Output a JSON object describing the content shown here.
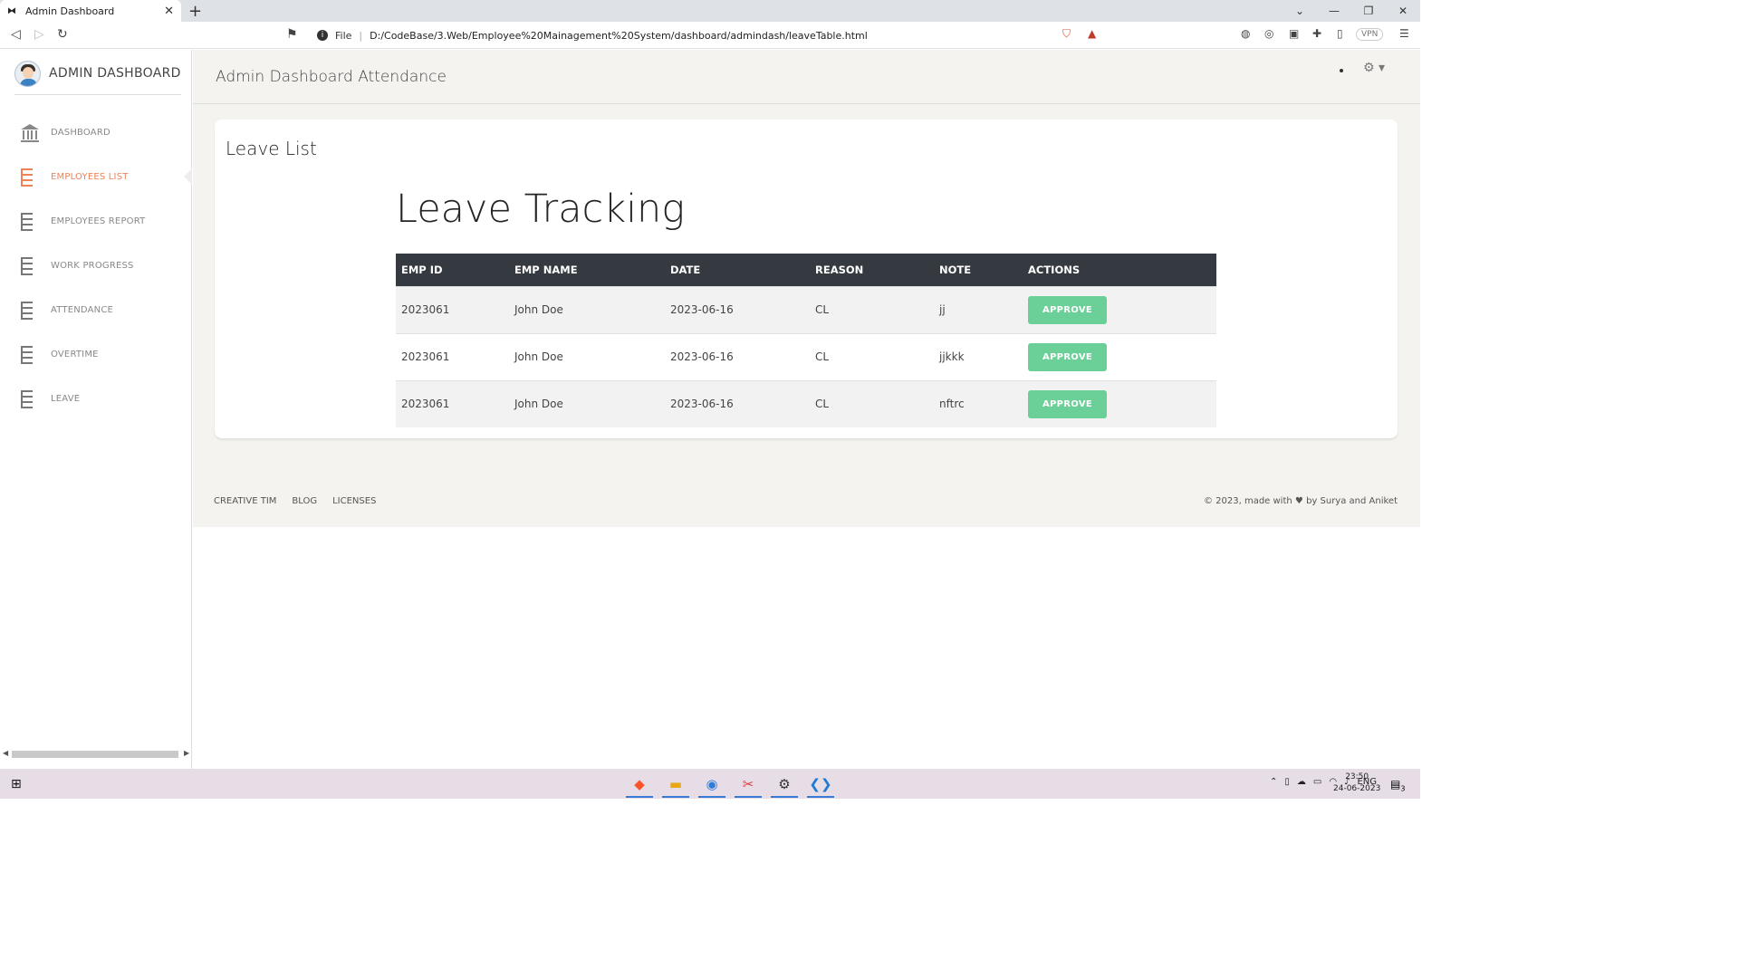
{
  "browser": {
    "tab_title": "Admin Dashboard",
    "tab_close": "✕",
    "new_tab": "+",
    "url_protocol": "File",
    "url": "D:/CodeBase/3.Web/Employee%20Mainagement%20System/dashboard/admindash/leaveTable.html",
    "vpn_label": "VPN",
    "window_controls": [
      "⌄",
      "—",
      "❐",
      "✕"
    ]
  },
  "sidebar": {
    "brand": "ADMIN DASHBOARD",
    "items": [
      {
        "label": "DASHBOARD",
        "icon": "bank-icon",
        "active": false
      },
      {
        "label": "EMPLOYEES LIST",
        "icon": "list-icon",
        "active": true
      },
      {
        "label": "EMPLOYEES REPORT",
        "icon": "list-icon",
        "active": false
      },
      {
        "label": "WORK PROGRESS",
        "icon": "list-icon",
        "active": false
      },
      {
        "label": "ATTENDANCE",
        "icon": "list-icon",
        "active": false
      },
      {
        "label": "OVERTIME",
        "icon": "list-icon",
        "active": false
      },
      {
        "label": "LEAVE",
        "icon": "list-icon",
        "active": false
      }
    ]
  },
  "header": {
    "title": "Admin Dashboard Attendance"
  },
  "card": {
    "title": "Leave List",
    "heading": "Leave Tracking",
    "columns": [
      "EMP ID",
      "EMP NAME",
      "DATE",
      "REASON",
      "NOTE",
      "ACTIONS"
    ],
    "rows": [
      {
        "emp_id": "2023061",
        "emp_name": "John Doe",
        "date": "2023-06-16",
        "reason": "CL",
        "note": "jj",
        "action": "APPROVE"
      },
      {
        "emp_id": "2023061",
        "emp_name": "John Doe",
        "date": "2023-06-16",
        "reason": "CL",
        "note": "jjkkk",
        "action": "APPROVE"
      },
      {
        "emp_id": "2023061",
        "emp_name": "John Doe",
        "date": "2023-06-16",
        "reason": "CL",
        "note": "nftrc",
        "action": "APPROVE"
      }
    ]
  },
  "footer": {
    "links": [
      "CREATIVE TIM",
      "BLOG",
      "LICENSES"
    ],
    "credit_prefix": "© 2023, made with",
    "credit_suffix": "by Surya and Aniket"
  },
  "taskbar": {
    "language": "ENG",
    "time": "23:50",
    "date": "24-06-2023",
    "notifications": "3"
  },
  "colors": {
    "accent": "#ef8157",
    "approve": "#6bd098",
    "table_header": "#343a40",
    "content_bg": "#f4f3ef"
  }
}
